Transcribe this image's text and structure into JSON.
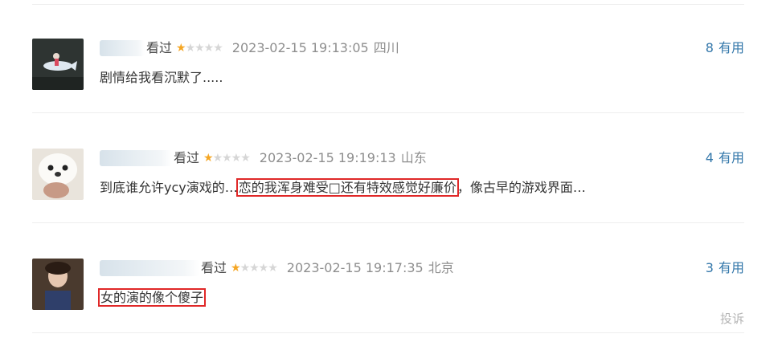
{
  "comments": [
    {
      "status": "看过",
      "rating": 1,
      "time": "2023-02-15 19:13:05",
      "location": "四川",
      "vote_count": "8",
      "vote_label": "有用",
      "content_before": "剧情给我看沉默了.....",
      "content_highlight": "",
      "content_after": ""
    },
    {
      "status": "看过",
      "rating": 1,
      "time": "2023-02-15 19:19:13",
      "location": "山东",
      "vote_count": "4",
      "vote_label": "有用",
      "content_before": "到底谁允许ycy演戏的…",
      "content_highlight": "恋的我浑身难受□还有特效感觉好廉价",
      "content_after": "，像古早的游戏界面…"
    },
    {
      "status": "看过",
      "rating": 1,
      "time": "2023-02-15 19:17:35",
      "location": "北京",
      "vote_count": "3",
      "vote_label": "有用",
      "content_before": "",
      "content_highlight": "女的演的像个傻子",
      "content_after": ""
    }
  ],
  "report_label": "投诉",
  "colors": {
    "link": "#3377aa",
    "star": "#f5a623",
    "highlight_box": "#e02828"
  }
}
